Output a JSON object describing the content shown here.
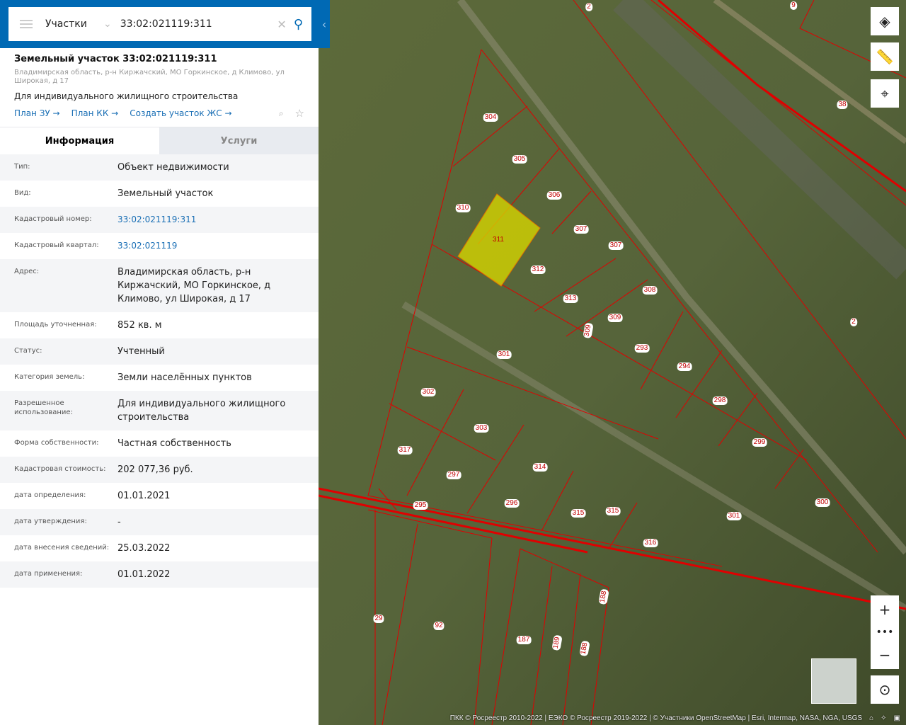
{
  "search": {
    "category": "Участки",
    "query": "33:02:021119:311"
  },
  "card": {
    "title": "Земельный участок 33:02:021119:311",
    "address": "Владимирская область, р-н Киржачский, МО Горкинское, д Климово, ул Широкая, д 17",
    "purpose": "Для индивидуального жилищного строительства",
    "links": [
      "План ЗУ →",
      "План КК →",
      "Создать участок ЖС →"
    ]
  },
  "tabs": [
    "Информация",
    "Услуги"
  ],
  "info": [
    {
      "k": "Тип:",
      "v": "Объект недвижимости"
    },
    {
      "k": "Вид:",
      "v": "Земельный участок"
    },
    {
      "k": "Кадастровый номер:",
      "v": "33:02:021119:311"
    },
    {
      "k": "Кадастровый квартал:",
      "v": "33:02:021119"
    },
    {
      "k": "Адрес:",
      "v": "Владимирская область, р-н Киржачский, МО Горкинское, д Климово, ул Широкая, д 17"
    },
    {
      "k": "Площадь уточненная:",
      "v": "852 кв. м"
    },
    {
      "k": "Статус:",
      "v": "Учтенный"
    },
    {
      "k": "Категория земель:",
      "v": "Земли населённых пунктов"
    },
    {
      "k": "Разрешенное использование:",
      "v": "Для индивидуального жилищного строительства"
    },
    {
      "k": "Форма собственности:",
      "v": "Частная собственность"
    },
    {
      "k": "Кадастровая стоимость:",
      "v": "202 077,36 руб."
    },
    {
      "k": "дата определения:",
      "v": "01.01.2021"
    },
    {
      "k": "дата утверждения:",
      "v": "-"
    },
    {
      "k": "дата внесения сведений:",
      "v": "25.03.2022"
    },
    {
      "k": "дата применения:",
      "v": "01.01.2022"
    }
  ],
  "map": {
    "parcel_labels": [
      "2",
      "9",
      "38",
      "304",
      "305",
      "306",
      "310",
      "311",
      "307",
      "307",
      "312",
      "308",
      "313",
      "309",
      "309",
      "2",
      "293",
      "301",
      "294",
      "302",
      "298",
      "303",
      "299",
      "317",
      "314",
      "297",
      "295",
      "296",
      "315",
      "315",
      "300",
      "301",
      "316",
      "188",
      "29",
      "92",
      "187",
      "189",
      "188"
    ],
    "attribution": "ПКК © Росреестр 2010-2022 | ЕЭКО © Росреестр 2019-2022 | © Участники OpenStreetMap | Esri, Intermap, NASA, NGA, USGS",
    "selected_color": "#d4d400",
    "boundary_color": "#e00000"
  }
}
